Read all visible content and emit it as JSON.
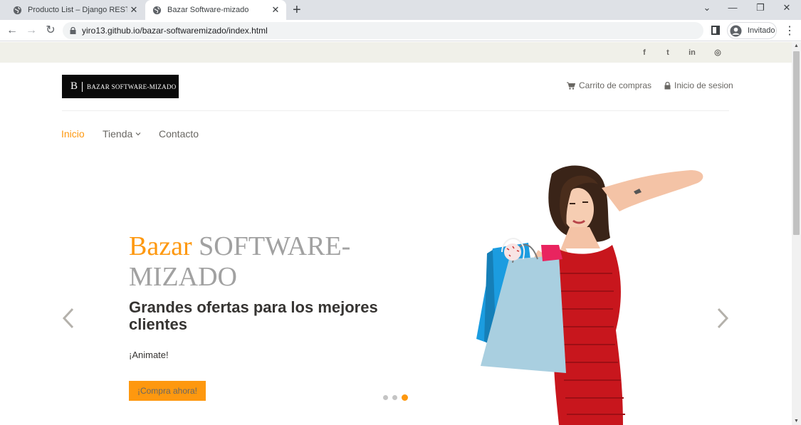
{
  "browser": {
    "tabs": [
      {
        "title": "Producto List – Django REST fram",
        "active": false
      },
      {
        "title": "Bazar Software-mizado",
        "active": true
      }
    ],
    "new_tab": "+",
    "window_controls": {
      "minimize": "—",
      "restore": "❐",
      "close": "✕",
      "tab_list": "⌄"
    },
    "url": "yiro13.github.io/bazar-softwaremizado/index.html",
    "profile_label": "Invitado"
  },
  "topbar": {
    "social": [
      {
        "icon": "facebook-icon",
        "glyph": "f"
      },
      {
        "icon": "twitter-icon",
        "glyph": "t"
      },
      {
        "icon": "linkedin-icon",
        "glyph": "in"
      },
      {
        "icon": "instagram-icon",
        "glyph": "◎"
      }
    ]
  },
  "header": {
    "logo_mark": "B",
    "logo_text": "BAZAR SOFTWARE-MIZADO",
    "cart_label": "Carrito de compras",
    "login_label": "Inicio de sesion"
  },
  "nav": {
    "items": [
      {
        "label": "Inicio",
        "active": true
      },
      {
        "label": "Tienda",
        "dropdown": true
      },
      {
        "label": "Contacto"
      }
    ]
  },
  "slider": {
    "title_accent": "Bazar",
    "title_rest": " SOFTWARE-MIZADO",
    "subtitle": "Grandes ofertas para los mejores clientes",
    "text": "¡Animate!",
    "button_label": "¡Compra ahora!",
    "slide_count": 3,
    "active_slide": 3
  },
  "colors": {
    "accent": "#fe980f",
    "topbar_bg": "#f0f0e9",
    "text_gray": "#696763",
    "dress_red": "#c8161d"
  }
}
